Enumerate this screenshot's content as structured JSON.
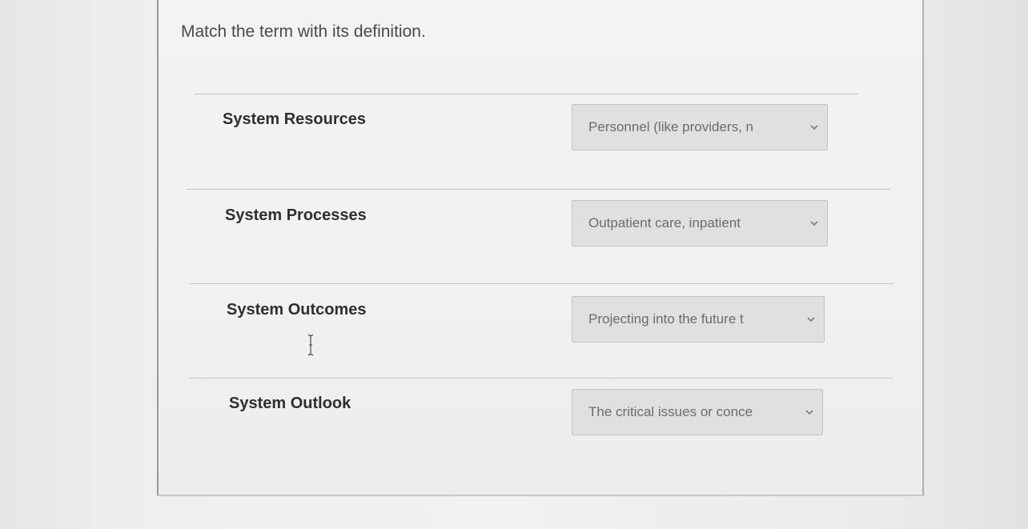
{
  "question": {
    "instructions": "Match the term with its definition."
  },
  "rows": [
    {
      "term": "System Resources",
      "selected": "Personnel (like providers, n"
    },
    {
      "term": "System Processes",
      "selected": "Outpatient care, inpatient"
    },
    {
      "term": "System Outcomes",
      "selected": "Projecting into the future t"
    },
    {
      "term": "System Outlook",
      "selected": "The critical issues or conce"
    }
  ],
  "icons": {
    "dropdown": "chevron-down-icon",
    "cursor": "text-cursor-icon"
  }
}
